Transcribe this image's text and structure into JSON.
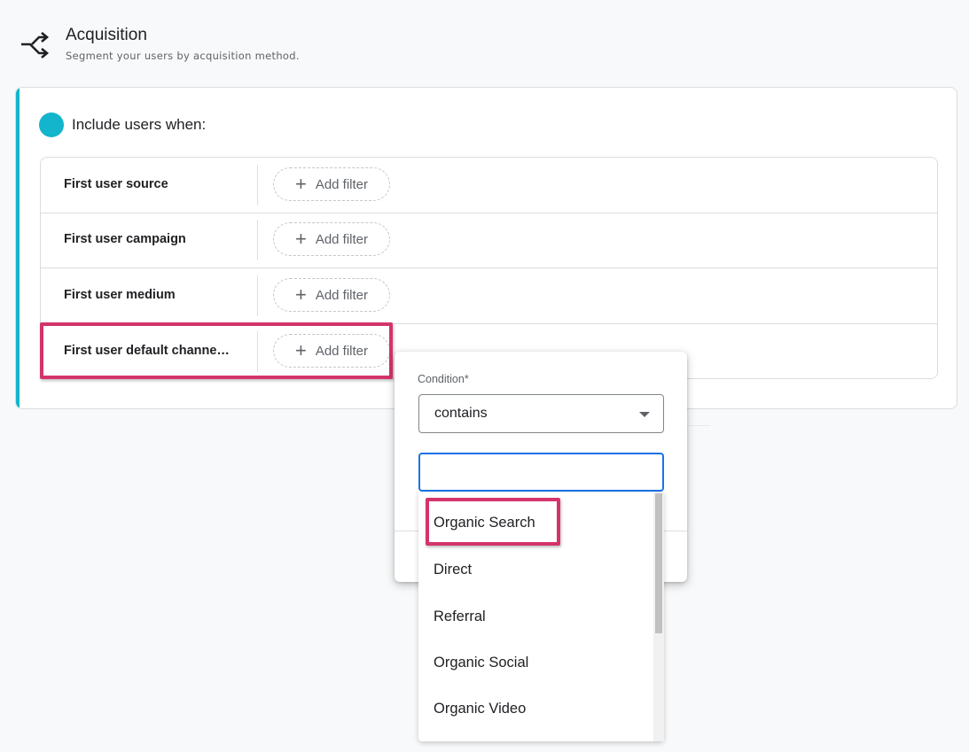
{
  "header": {
    "title": "Acquisition",
    "subtitle": "Segment your users by acquisition method.",
    "icon": "shuffle-icon"
  },
  "card": {
    "include_label": "Include users when:",
    "accent_color": "#12b5cb",
    "rows": [
      {
        "label": "First user source",
        "action": "Add filter"
      },
      {
        "label": "First user campaign",
        "action": "Add filter"
      },
      {
        "label": "First user medium",
        "action": "Add filter"
      },
      {
        "label": "First user default channe…",
        "action": "Add filter"
      }
    ]
  },
  "popup": {
    "condition_label": "Condition*",
    "condition_value": "contains",
    "search_value": "",
    "options": [
      "Organic Search",
      "Direct",
      "Referral",
      "Organic Social",
      "Organic Video"
    ]
  },
  "colors": {
    "highlight": "#d4336b",
    "focus": "#1a73e8"
  }
}
